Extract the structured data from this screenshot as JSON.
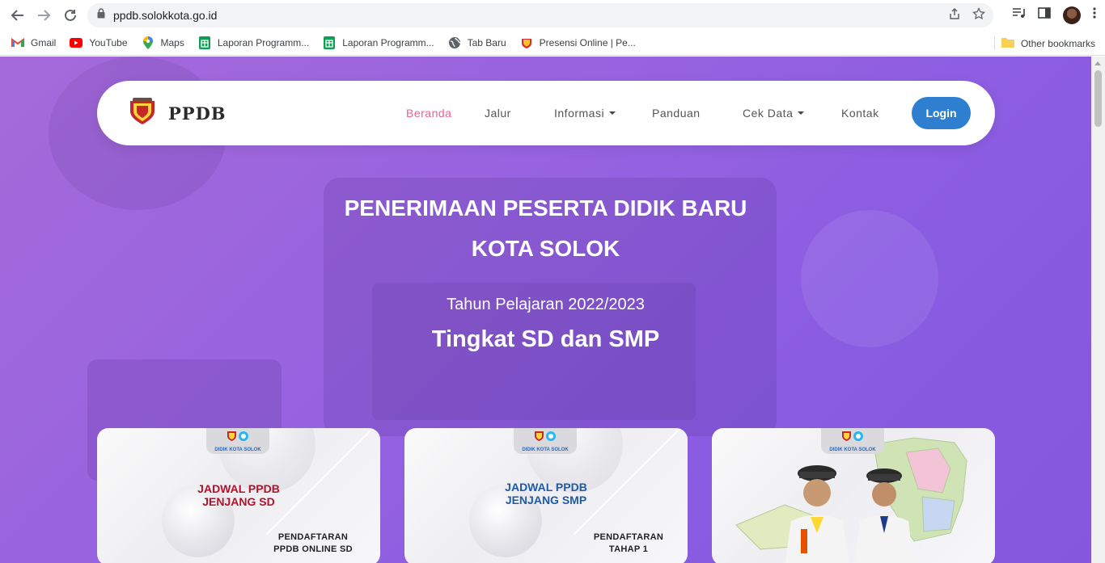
{
  "browser": {
    "url": "ppdb.solokkota.go.id",
    "bookmarks": [
      {
        "label": "Gmail",
        "icon": "gmail-icon",
        "color": "#ea4335"
      },
      {
        "label": "YouTube",
        "icon": "youtube-icon",
        "color": "#ff0000"
      },
      {
        "label": "Maps",
        "icon": "maps-icon",
        "color": "#34a853"
      },
      {
        "label": "Laporan Programm...",
        "icon": "sheets-icon",
        "color": "#0f9d58"
      },
      {
        "label": "Laporan Programm...",
        "icon": "sheets-icon",
        "color": "#0f9d58"
      },
      {
        "label": "Tab Baru",
        "icon": "globe-icon",
        "color": "#5f6368"
      },
      {
        "label": "Presensi Online | Pe...",
        "icon": "emblem-icon",
        "color": "#d32f2f"
      }
    ],
    "other_bookmarks": "Other bookmarks"
  },
  "site": {
    "brand": "PPDB",
    "menu": {
      "beranda": "Beranda",
      "jalur": "Jalur",
      "informasi": "Informasi",
      "panduan": "Panduan",
      "cek_data": "Cek Data",
      "kontak": "Kontak",
      "login": "Login"
    },
    "accent_color": "#e8638f",
    "login_color": "#2e7fd0"
  },
  "hero": {
    "line1": "PENERIMAAN PESERTA DIDIK BARU",
    "line2": "KOTA SOLOK",
    "year": "Tahun Pelajaran 2022/2023",
    "level": "Tingkat SD dan SMP"
  },
  "cards": [
    {
      "tab_label": "DIDIK KOTA SOLOK",
      "heading1": "JADWAL PPDB",
      "heading2": "JENJANG SD",
      "heading_color": "#b3122a",
      "sub1": "PENDAFTARAN",
      "sub2": "PPDB ONLINE SD"
    },
    {
      "tab_label": "DIDIK KOTA SOLOK",
      "heading1": "JADWAL PPDB",
      "heading2": "JENJANG SMP",
      "heading_color": "#1f5aa6",
      "sub1": "PENDAFTARAN",
      "sub2": "TAHAP 1"
    },
    {
      "tab_label": "DIDIK KOTA SOLOK"
    }
  ]
}
